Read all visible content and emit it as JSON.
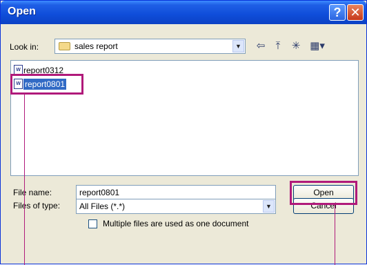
{
  "window": {
    "title": "Open",
    "help_glyph": "?",
    "close_glyph": "✕"
  },
  "look_in": {
    "label": "Look in:",
    "value": "sales report"
  },
  "toolbar": {
    "back_glyph": "⇦",
    "up_glyph": "⤒",
    "new_folder_glyph": "✳",
    "views_glyph": "▦▾"
  },
  "files": [
    {
      "name": "report0312",
      "icon": "word-document-icon",
      "selected": false
    },
    {
      "name": "report0801",
      "icon": "word-document-icon",
      "selected": true
    }
  ],
  "file_name": {
    "label": "File name:",
    "value": "report0801"
  },
  "file_type": {
    "label": "Files of type:",
    "value": "All Files (*.*)"
  },
  "buttons": {
    "open": "Open",
    "cancel": "Cancel"
  },
  "options": {
    "multiple_files_label": "Multiple files are used as one document",
    "multiple_files_checked": false
  },
  "icon_glyphs": {
    "doc": "W",
    "dropdown": "▼"
  },
  "colors": {
    "highlight": "#b0197a",
    "selection": "#316ac5",
    "titlebar": "#0f4dd9"
  }
}
